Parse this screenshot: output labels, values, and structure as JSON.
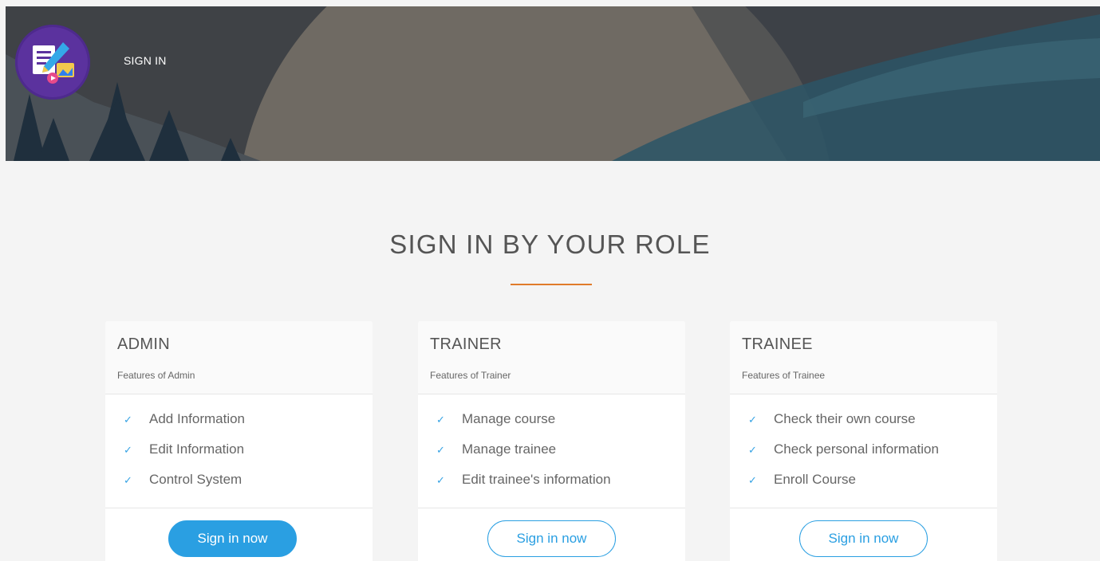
{
  "header": {
    "nav_signin": "SIGN IN"
  },
  "main": {
    "title": "SIGN IN BY YOUR ROLE",
    "accent_color": "#e07b2a",
    "button_color": "#2a9fe2",
    "cards": [
      {
        "title": "ADMIN",
        "subtitle": "Features of Admin",
        "features": [
          "Add Information",
          "Edit Information",
          "Control System"
        ],
        "button_label": "Sign in now",
        "button_style": "filled"
      },
      {
        "title": "TRAINER",
        "subtitle": "Features of Trainer",
        "features": [
          "Manage course",
          "Manage trainee",
          "Edit trainee's information"
        ],
        "button_label": "Sign in now",
        "button_style": "outline"
      },
      {
        "title": "TRAINEE",
        "subtitle": "Features of Trainee",
        "features": [
          "Check their own course",
          "Check personal information",
          "Enroll Course"
        ],
        "button_label": "Sign in now",
        "button_style": "outline"
      }
    ]
  },
  "icons": {
    "check": "check-icon",
    "logo": "logo-icon"
  }
}
